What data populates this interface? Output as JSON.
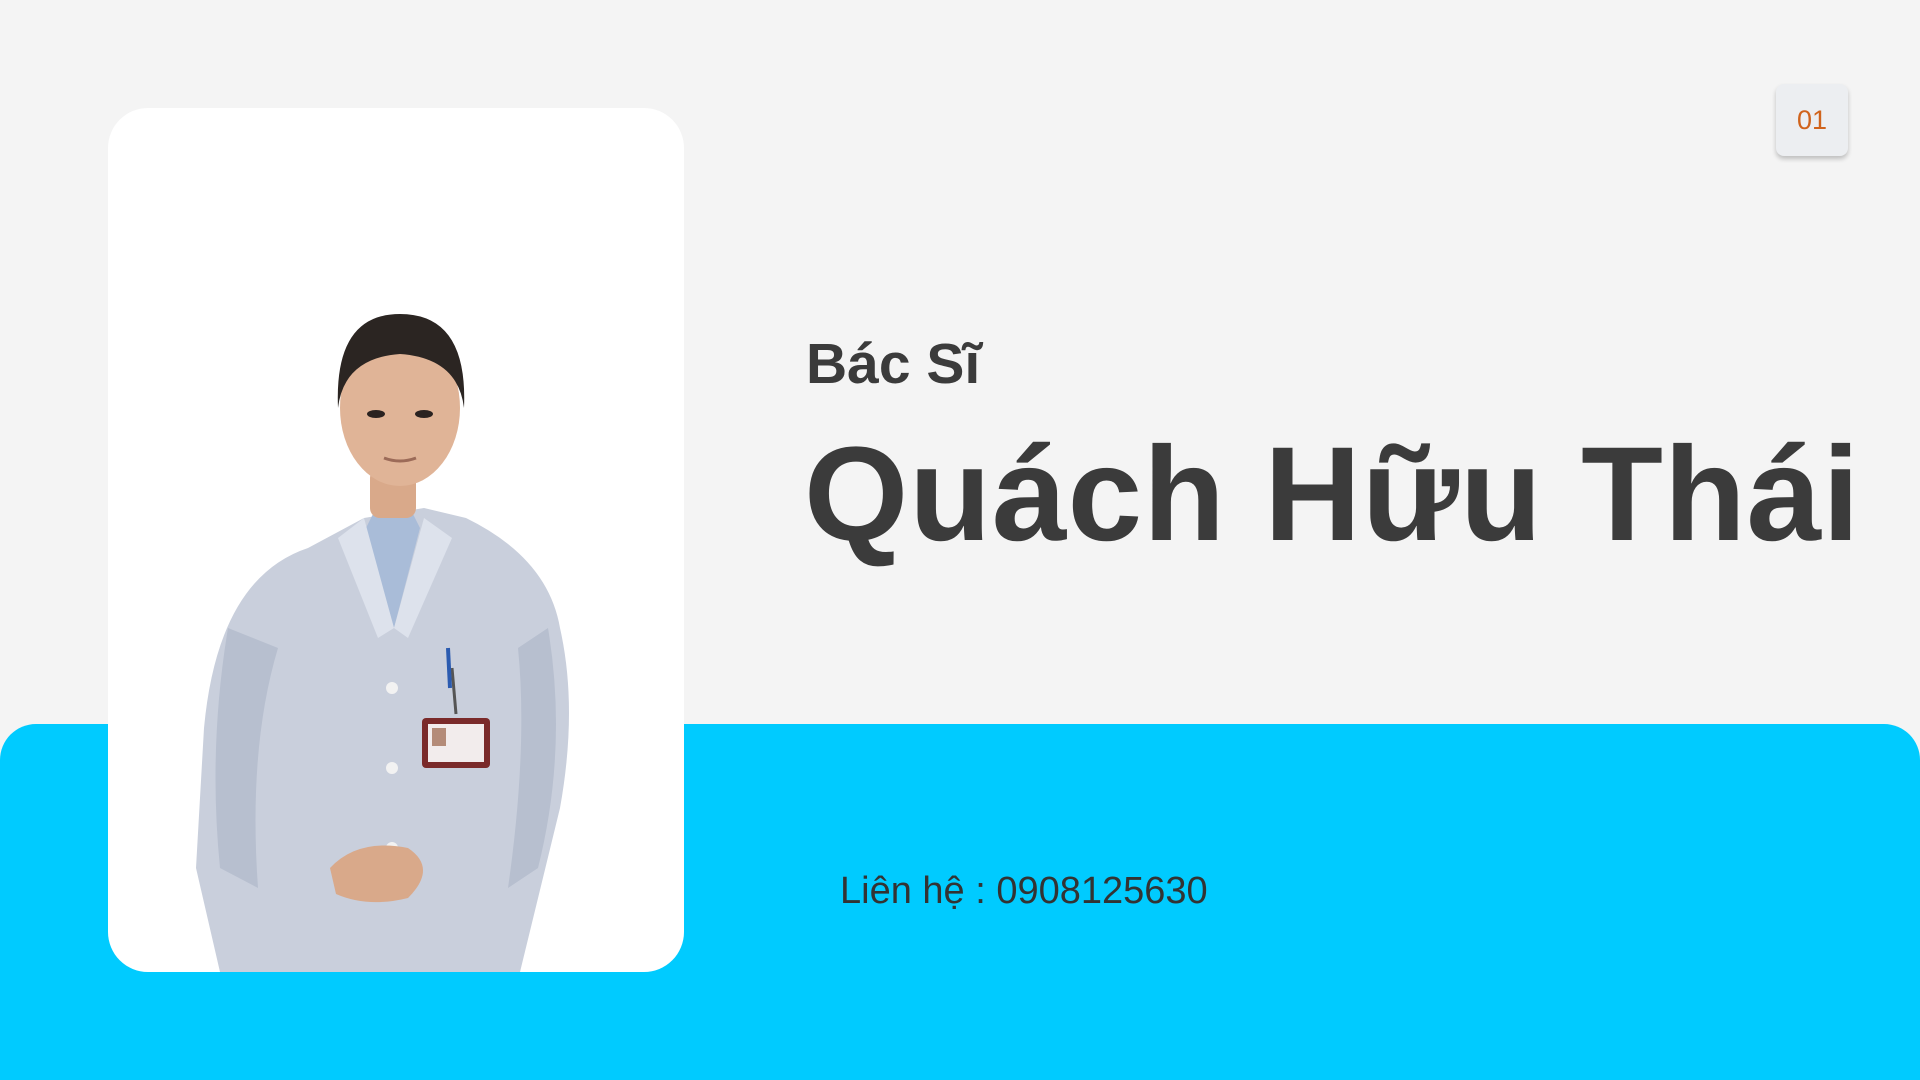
{
  "slide": {
    "page_number": "01",
    "title_prefix": "Bác Sĩ",
    "doctor_name": "Quách Hữu Thái",
    "contact_line": "Liên hệ : 0908125630"
  },
  "photo": {
    "subject": "doctor-portrait",
    "attire": "white lab coat with ID badge"
  },
  "colors": {
    "background": "#f4f4f4",
    "accent_band": "#00cbff",
    "title_text": "#3b3b3b",
    "page_number": "#d0631c"
  }
}
